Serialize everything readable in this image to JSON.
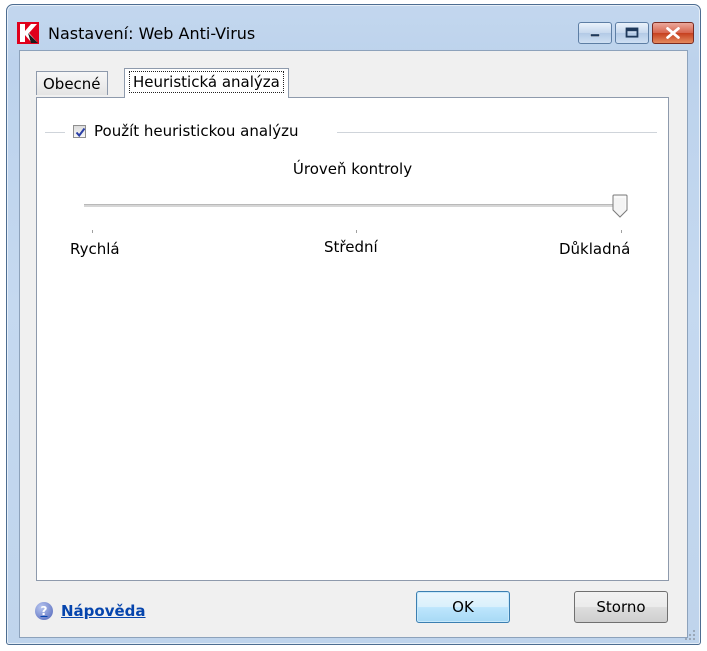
{
  "window": {
    "title": "Nastavení: Web Anti-Virus"
  },
  "tabs": [
    {
      "label": "Obecné",
      "active": false
    },
    {
      "label": "Heuristická analýza",
      "active": true
    }
  ],
  "heuristic": {
    "checkbox_label": "Použít heuristickou analýzu",
    "checked": true,
    "level_label": "Úroveň kontroly",
    "levels": [
      "Rychlá",
      "Střední",
      "Důkladná"
    ],
    "selected_level": "Důkladná"
  },
  "footer": {
    "help_label": "Nápověda",
    "ok_label": "OK",
    "cancel_label": "Storno"
  },
  "colors": {
    "frame": "#bfd4ec",
    "link": "#0645ad",
    "logo_red": "#e0001b"
  }
}
